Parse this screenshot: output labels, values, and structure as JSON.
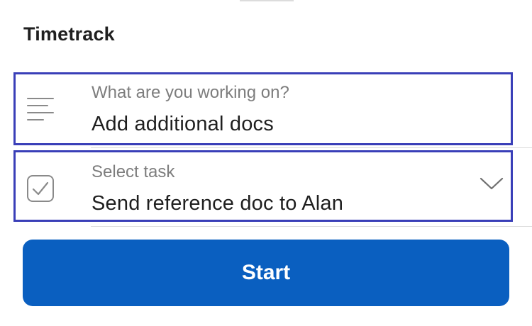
{
  "header": {
    "title": "Timetrack"
  },
  "description_field": {
    "label": "What are you working on?",
    "value": "Add additional docs",
    "icon": "description-lines-icon"
  },
  "task_field": {
    "label": "Select task",
    "value": "Send reference doc to Alan",
    "icon": "checkbox-icon",
    "dropdown_icon": "chevron-down-icon"
  },
  "actions": {
    "start_label": "Start"
  },
  "colors": {
    "accent": "#0a5fc0",
    "focus_border": "#3a3fb8",
    "text": "#1f1f1f",
    "label": "#7d7d7d"
  }
}
